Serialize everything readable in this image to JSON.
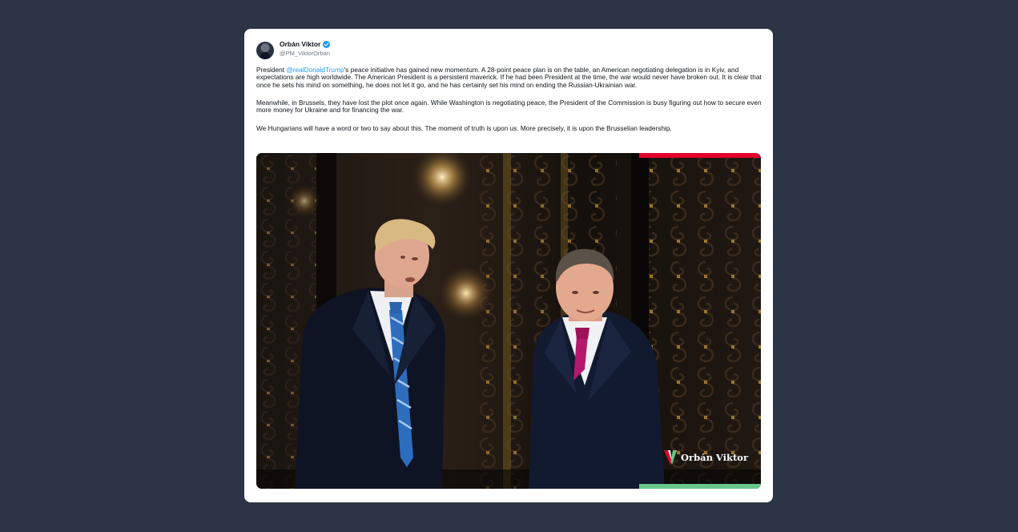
{
  "post": {
    "author_name": "Orbán Viktor",
    "handle": "@PM_ViktorOrban",
    "verified": true,
    "paragraph1_before": "President ",
    "paragraph1_mention": "@realDonaldTrump",
    "paragraph1_after": "'s peace initiative has gained new momentum. A 28-point peace plan is on the table, an American negotiating delegation is in Kyiv, and expectations are high worldwide. The American President is a persistent maverick. If he had been President at the time, the war would never have broken out.  It is clear that once he sets his mind on something, he does not let it go, and he has certainly set his mind on ending the Russian-Ukrainian war.",
    "paragraph2": "Meanwhile, in Brussels, they have lost the plot once again. While Washington is negotiating peace, the President of the Commission is busy figuring out how to secure even more money for Ukraine and for financing the war.",
    "paragraph3": "We Hungarians will have a word or two to say about this. The moment of truth is upon us. More precisely, it is upon the Brusselian leadership.",
    "image_watermark": "Orbán Viktor"
  },
  "colors": {
    "page_background": "#2d3445",
    "mention": "#1d9bf0",
    "verified_badge": "#1d9bf0",
    "flag_red": "#e3002b",
    "flag_green": "#67c68a"
  },
  "icons": {
    "verified": "verified-badge-icon",
    "watermark_logo": "orban-logo-icon"
  }
}
